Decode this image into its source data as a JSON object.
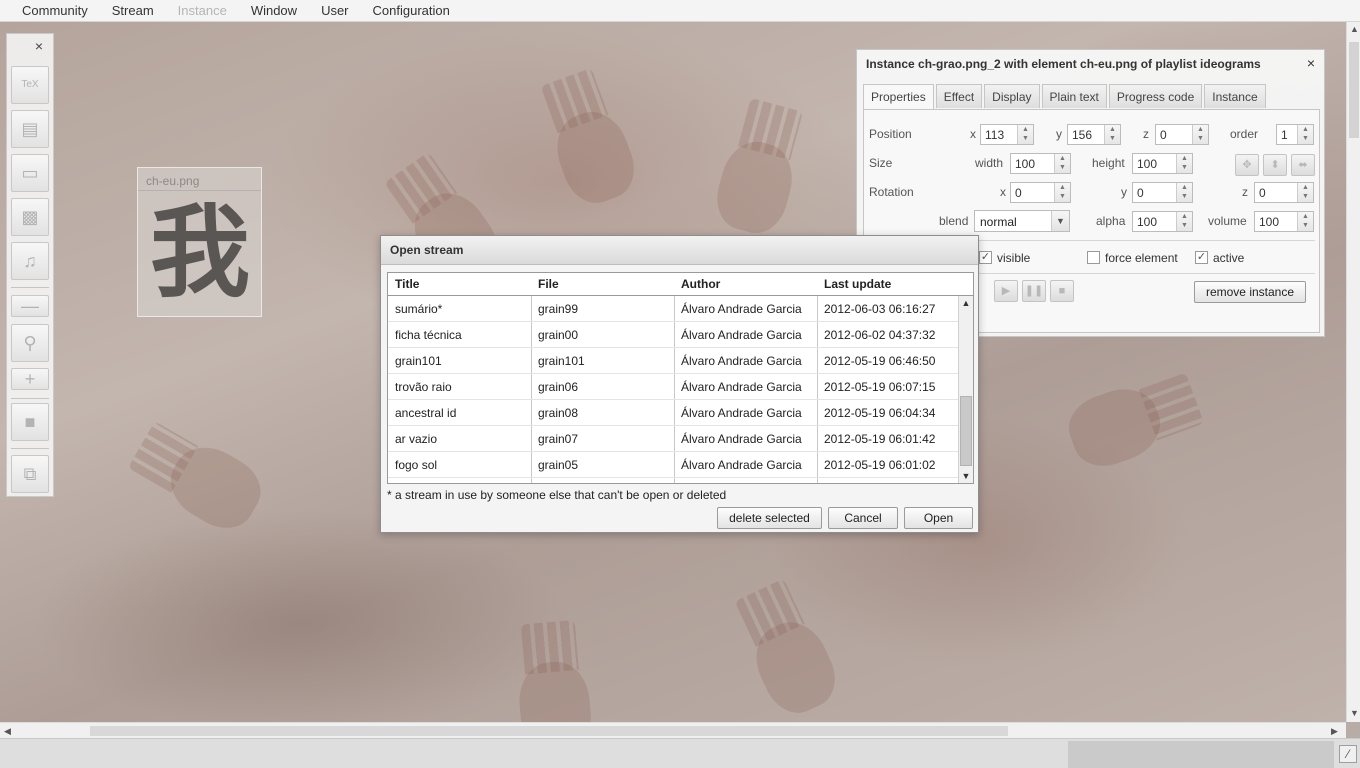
{
  "menu": [
    {
      "label": "Community",
      "enabled": true
    },
    {
      "label": "Stream",
      "enabled": true
    },
    {
      "label": "Instance",
      "enabled": false
    },
    {
      "label": "Window",
      "enabled": true
    },
    {
      "label": "User",
      "enabled": true
    },
    {
      "label": "Configuration",
      "enabled": true
    }
  ],
  "toolbar": {
    "close": "×",
    "tools": [
      "tex-icon",
      "document-icon",
      "rectangle-icon",
      "video-icon",
      "music-icon",
      "minus-icon",
      "zoom-icon",
      "plus-icon",
      "square-icon",
      "windows-icon"
    ],
    "tex_glyph": "TeX"
  },
  "element_thumb": {
    "label": "ch-eu.png",
    "glyph": "我"
  },
  "instance_panel": {
    "title": "Instance ch-grao.png_2 with element ch-eu.png of playlist ideograms",
    "close": "×",
    "tabs": [
      "Properties",
      "Effect",
      "Display",
      "Plain text",
      "Progress code",
      "Instance"
    ],
    "active_tab": "Properties",
    "position": {
      "label": "Position",
      "x_label": "x",
      "x": "113",
      "y_label": "y",
      "y": "156",
      "z_label": "z",
      "z": "0",
      "order_label": "order",
      "order": "1"
    },
    "size": {
      "label": "Size",
      "width_label": "width",
      "width": "100",
      "height_label": "height",
      "height": "100"
    },
    "rotation": {
      "label": "Rotation",
      "x_label": "x",
      "x": "0",
      "y_label": "y",
      "y": "0",
      "z_label": "z",
      "z": "0"
    },
    "blend": {
      "label": "blend",
      "value": "normal",
      "alpha_label": "alpha",
      "alpha": "100",
      "volume_label": "volume",
      "volume": "100"
    },
    "visible": {
      "label": "visible",
      "checked": true
    },
    "force_element": {
      "label": "force element",
      "checked": false
    },
    "active": {
      "label": "active",
      "checked": true
    },
    "remove_button": "remove instance"
  },
  "dialog": {
    "title": "Open stream",
    "columns": [
      "Title",
      "File",
      "Author",
      "Last update"
    ],
    "rows": [
      [
        "sumário*",
        "grain99",
        "Álvaro Andrade Garcia",
        "2012-06-03 06:16:27"
      ],
      [
        "ficha técnica",
        "grain00",
        "Álvaro Andrade Garcia",
        "2012-06-02 04:37:32"
      ],
      [
        "grain101",
        "grain101",
        "Álvaro Andrade Garcia",
        "2012-05-19 06:46:50"
      ],
      [
        "trovão raio",
        "grain06",
        "Álvaro Andrade Garcia",
        "2012-05-19 06:07:15"
      ],
      [
        "ancestral id",
        "grain08",
        "Álvaro Andrade Garcia",
        "2012-05-19 06:04:34"
      ],
      [
        "ar vazio",
        "grain07",
        "Álvaro Andrade Garcia",
        "2012-05-19 06:01:42"
      ],
      [
        "fogo sol",
        "grain05",
        "Álvaro Andrade Garcia",
        "2012-05-19 06:01:02"
      ]
    ],
    "note": "* a stream in use by someone else that can't be open or deleted",
    "buttons": {
      "delete": "delete selected",
      "cancel": "Cancel",
      "open": "Open"
    }
  }
}
